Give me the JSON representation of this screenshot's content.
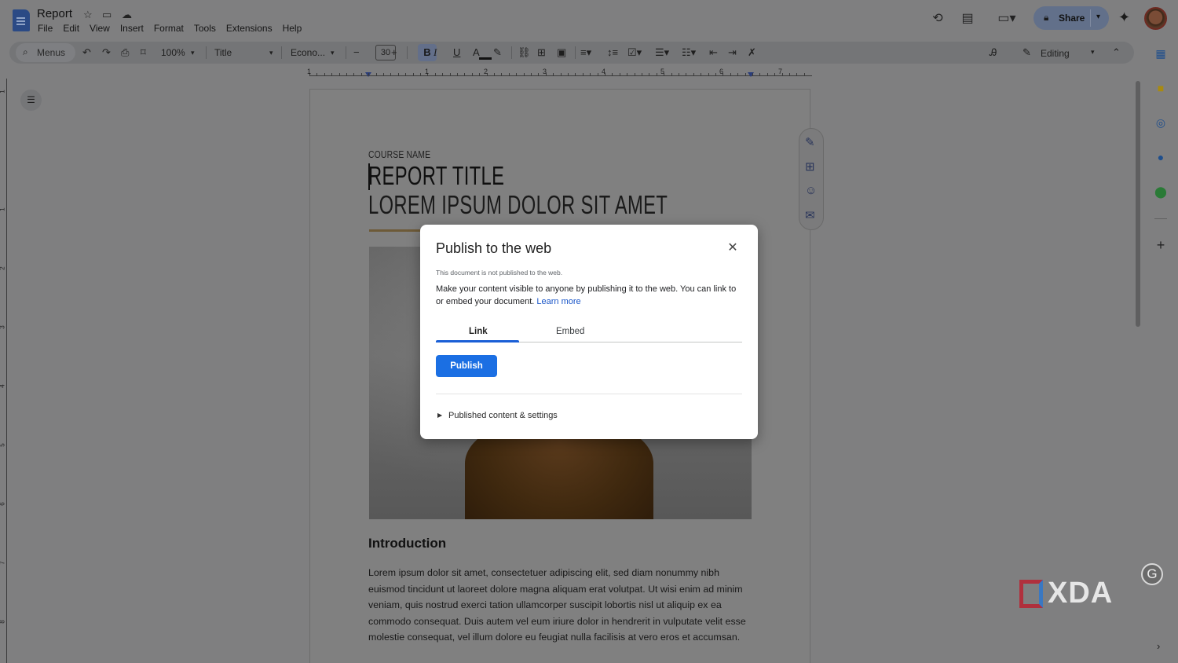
{
  "app": {
    "doc_title": "Report",
    "menu": [
      "File",
      "Edit",
      "View",
      "Insert",
      "Format",
      "Tools",
      "Extensions",
      "Help"
    ],
    "share_label": "Share"
  },
  "toolbar": {
    "search_placeholder": "Menus",
    "zoom": "100%",
    "style": "Title",
    "font": "Econo...",
    "font_size": "30",
    "bold_label": "B",
    "italic_label": "I",
    "underline_label": "U",
    "color_label": "A",
    "mode": "Editing"
  },
  "ruler": {
    "h_numbers": [
      "1",
      "1",
      "2",
      "3",
      "4",
      "5",
      "6",
      "7"
    ],
    "v_numbers": [
      "1",
      "1",
      "2",
      "3",
      "4",
      "5",
      "6",
      "7",
      "8"
    ]
  },
  "document": {
    "course_name": "COURSE NAME",
    "title": "REPORT TITLE",
    "subtitle": "LOREM IPSUM DOLOR SIT AMET",
    "intro_heading": "Introduction",
    "intro_body": "Lorem ipsum dolor sit amet, consectetuer adipiscing elit, sed diam nonummy nibh euismod tincidunt ut laoreet dolore magna aliquam erat volutpat. Ut wisi enim ad minim veniam, quis nostrud exerci tation ullamcorper suscipit lobortis nisl ut aliquip ex ea commodo consequat. Duis autem vel eum iriure dolor in hendrerit in vulputate velit esse molestie consequat, vel illum dolore eu feugiat nulla facilisis at vero eros et accumsan."
  },
  "dialog": {
    "title": "Publish to the web",
    "status": "This document is not published to the web.",
    "description": "Make your content visible to anyone by publishing it to the web. You can link to or embed your document. ",
    "learn_more": "Learn more",
    "tabs": [
      "Link",
      "Embed"
    ],
    "active_tab": "Link",
    "publish_label": "Publish",
    "settings_label": "Published content & settings"
  },
  "watermark": "XDA",
  "colors": {
    "accent_blue": "#1b6fe3",
    "overlay_bg": "#7f7f80",
    "dialog_bg": "#ffffff",
    "title_rule": "#6d5a38"
  },
  "icons": {
    "topbar_right": [
      "history-icon",
      "comments-icon",
      "meet-icon",
      "lock-icon",
      "gemini-icon"
    ],
    "side_panel": [
      "calendar-icon",
      "keep-icon",
      "tasks-icon",
      "contacts-icon",
      "maps-icon",
      "add-icon"
    ],
    "float_actions": [
      "edit-suggest-icon",
      "add-comment-icon",
      "emoji-icon",
      "suggest-edits-icon"
    ]
  }
}
